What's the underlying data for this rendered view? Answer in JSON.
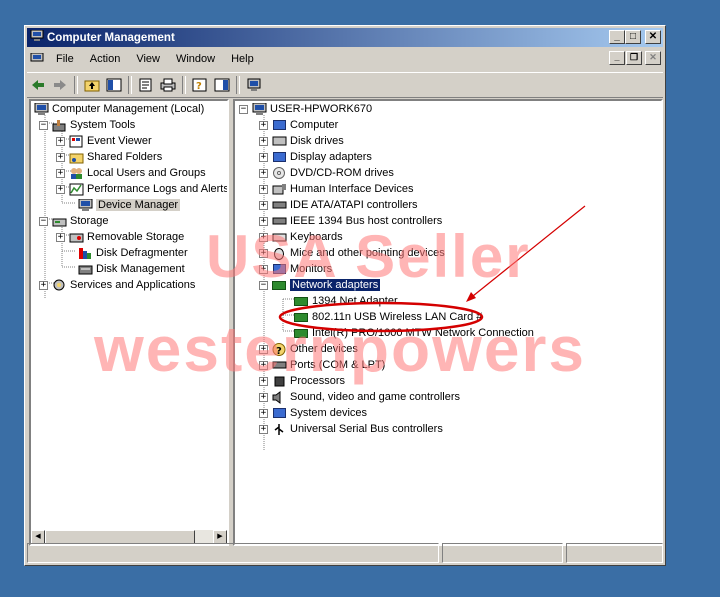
{
  "window": {
    "title": "Computer Management"
  },
  "menu": [
    "File",
    "Action",
    "View",
    "Window",
    "Help"
  ],
  "left_tree": [
    {
      "label": "Computer Management (Local)",
      "icon": "computer-icon"
    },
    {
      "label": "System Tools",
      "icon": "tools-icon"
    },
    {
      "label": "Event Viewer",
      "icon": "event-viewer-icon"
    },
    {
      "label": "Shared Folders",
      "icon": "folder-icon"
    },
    {
      "label": "Local Users and Groups",
      "icon": "users-icon"
    },
    {
      "label": "Performance Logs and Alerts",
      "icon": "performance-icon"
    },
    {
      "label": "Device Manager",
      "icon": "device-manager-icon"
    },
    {
      "label": "Storage",
      "icon": "storage-icon"
    },
    {
      "label": "Removable Storage",
      "icon": "removable-storage-icon"
    },
    {
      "label": "Disk Defragmenter",
      "icon": "defrag-icon"
    },
    {
      "label": "Disk Management",
      "icon": "disk-management-icon"
    },
    {
      "label": "Services and Applications",
      "icon": "services-icon"
    }
  ],
  "right_tree": {
    "root": "USER-HPWORK670",
    "items": [
      "Computer",
      "Disk drives",
      "Display adapters",
      "DVD/CD-ROM drives",
      "Human Interface Devices",
      "IDE ATA/ATAPI controllers",
      "IEEE 1394 Bus host controllers",
      "Keyboards",
      "Mice and other pointing devices",
      "Monitors",
      "Network adapters"
    ],
    "network_children": [
      "1394 Net Adapter",
      "802.11n USB Wireless LAN Card #",
      "Intel(R) PRO/1000 MTW Network Connection"
    ],
    "items_after": [
      "Other devices",
      "Ports (COM & LPT)",
      "Processors",
      "Sound, video and game controllers",
      "System devices",
      "Universal Serial Bus controllers"
    ]
  },
  "watermark": {
    "line1": "USA Seller",
    "line2": "westernpowers"
  },
  "colors": {
    "desktop": "#3a6ea5",
    "titlebar": "#0a246a",
    "highlight_ellipse": "#d40000"
  }
}
